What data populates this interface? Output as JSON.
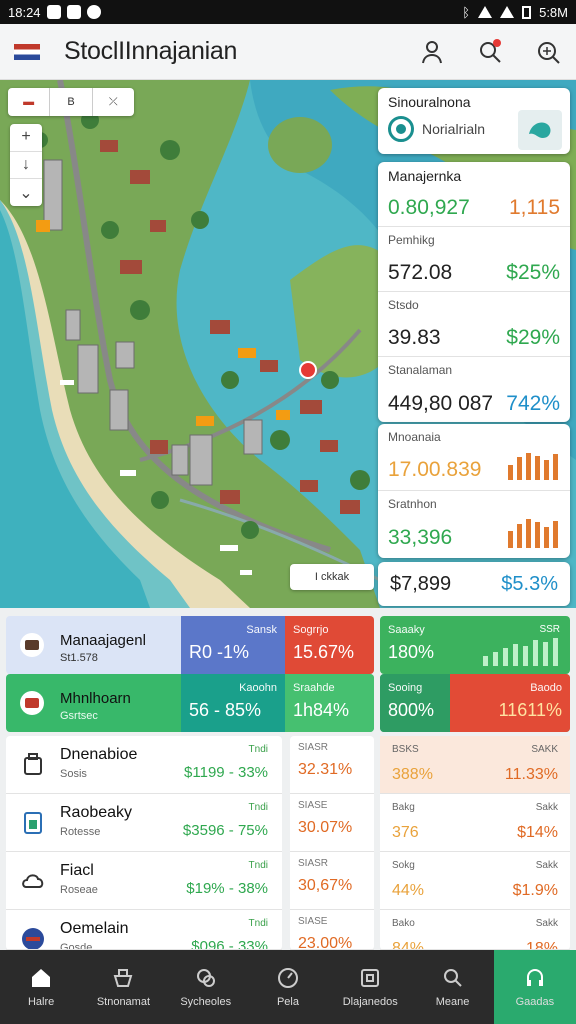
{
  "status": {
    "time": "18:24",
    "right": "5:8M"
  },
  "app": {
    "title": "StoclIInnajanian"
  },
  "map": {
    "mode_buttons": [
      "▬",
      "B",
      "⤫"
    ],
    "zoom_in": "+",
    "zoom_mid": "↓",
    "zoom_out": "⌄",
    "chip_label": "I  ckkak"
  },
  "side_top": {
    "title": "Sinouralnona",
    "subtitle": "Norialrialn"
  },
  "stats": [
    {
      "label": "Manajernka",
      "value": "0.80,927",
      "pct": "1,115"
    },
    {
      "label": "Pemhikg",
      "value": "572.08",
      "pct": "$25%"
    },
    {
      "label": "Stsdo",
      "value": "39.83",
      "pct": "$29%"
    },
    {
      "label": "Stanalaman",
      "value": "449,80 087",
      "pct": "742%"
    }
  ],
  "bars_cards": [
    {
      "label": "Mnoanaia",
      "value": "17.00.839",
      "heights": [
        0.5,
        0.75,
        0.9,
        0.8,
        0.65,
        0.85
      ]
    },
    {
      "label": "Sratnhon",
      "value": "33,396",
      "heights": [
        0.55,
        0.8,
        0.95,
        0.85,
        0.7,
        0.9
      ]
    }
  ],
  "side_foot": {
    "left": "$7,899",
    "right": "$5.3%"
  },
  "banners": {
    "b1": {
      "name": "Manaajagenl",
      "sub": "St1.578",
      "k1": "Sansk",
      "v1": "R0 -1%",
      "k2": "Sogrrjo",
      "v2": "15.67%"
    },
    "b2": {
      "name": "Mhnlhoarn",
      "sub": "Gsrtsec",
      "k1": "Kaoohn",
      "v1": "56 - 85%",
      "k2": "Sraahde",
      "v2": "1h84%"
    },
    "b3": {
      "k1": "Saaaky",
      "v1": "180%",
      "k2": "SSR"
    },
    "b4": {
      "k1": "Sooing",
      "v1": "800%",
      "k2": "Baodo",
      "v2": "11611%"
    }
  },
  "list": [
    {
      "name": "Dnenabioe",
      "sub": "Sosis",
      "tick": "Tndi",
      "value": "$1199 - 33%"
    },
    {
      "name": "Raobeaky",
      "sub": "Rotesse",
      "tick": "Tndi",
      "value": "$3596 - 75%"
    },
    {
      "name": "Fiacl",
      "sub": "Roseae",
      "tick": "Tndi",
      "value": "$19% - 38%"
    },
    {
      "name": "Oemelain",
      "sub": "Gosde",
      "tick": "Tndi",
      "value": "$096 - 33%"
    }
  ],
  "col2": [
    {
      "k": "SIASR",
      "v": "32.31%"
    },
    {
      "k": "SIASE",
      "v": "30.07%"
    },
    {
      "k": "SIASR",
      "v": "30,67%"
    },
    {
      "k": "SIASE",
      "v": "23.00%"
    }
  ],
  "col3": [
    {
      "k1": "BSKS",
      "v1": "388%",
      "k2": "SAKK",
      "v2": "11.33%"
    },
    {
      "k1": "Bakg",
      "v1": "376",
      "k2": "Sakk",
      "v2": "$14%"
    },
    {
      "k1": "Sokg",
      "v1": "44%",
      "k2": "Sakk",
      "v2": "$1.9%"
    },
    {
      "k1": "Bako",
      "v1": "84%",
      "k2": "Sakk",
      "v2": "18%"
    }
  ],
  "nav": [
    "Halre",
    "Stnonamat",
    "Sycheoles",
    "Pela",
    "Dlajanedos",
    "Meane",
    "Gaadas"
  ],
  "colors": {
    "green": "#2fa84f",
    "orange": "#e07a2e",
    "active_nav": "#2aaa6e",
    "blue_banner": "#5b77c9",
    "red_banner": "#e04a36"
  }
}
